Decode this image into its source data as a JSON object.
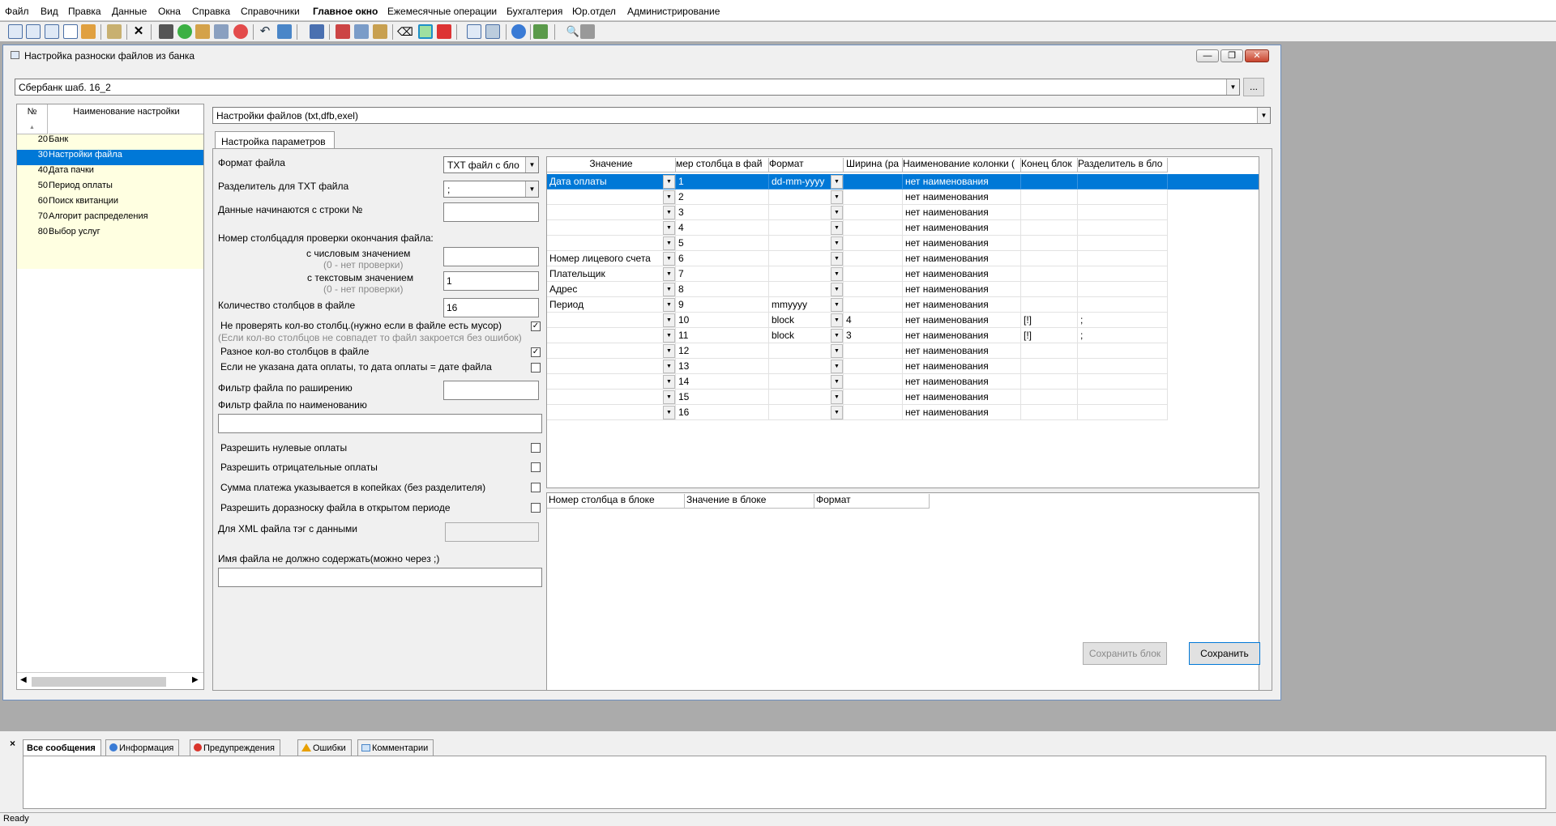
{
  "menu": [
    "Файл",
    "Вид",
    "Правка",
    "Данные",
    "Окна",
    "Справка",
    "Справочники",
    "Главное окно",
    "Ежемесячные операции",
    "Бухгалтерия",
    "Юр.отдел",
    "Администрирование"
  ],
  "window": {
    "title": "Настройка разноски файлов из банка",
    "template_value": "Сбербанк шаб. 16_2",
    "browse_label": "..."
  },
  "left_list": {
    "headers": [
      "№",
      "Наименование настройки"
    ],
    "items": [
      {
        "num": "20",
        "name": "Банк",
        "selected": false
      },
      {
        "num": "30",
        "name": "Настройки  файла",
        "selected": true
      },
      {
        "num": "40",
        "name": "Дата пачки",
        "selected": false
      },
      {
        "num": "50",
        "name": "Период оплаты",
        "selected": false
      },
      {
        "num": "60",
        "name": "Поиск квитанции",
        "selected": false
      },
      {
        "num": "70",
        "name": "Алгорит распределения",
        "selected": false
      },
      {
        "num": "80",
        "name": "Выбор услуг",
        "selected": false
      }
    ]
  },
  "settings_combo": "Настройки файлов (txt,dfb,exel)",
  "tab_label": "Настройка параметров",
  "form": {
    "file_format_label": "Формат файла",
    "file_format_value": "TXT файл с бло",
    "separator_label": "Разделитель для  TXT файла",
    "separator_value": ";",
    "start_row_label": "Данные начинаются с строки №",
    "start_row_value": "",
    "check_col_label": "Номер столбцадля проверки окончания файла:",
    "numeric_label": "с числовым значением",
    "numeric_hint": "(0 - нет проверки)",
    "numeric_value": "",
    "text_label": "с текстовым значением",
    "text_hint": "(0 - нет проверки)",
    "text_value": "1",
    "col_count_label": "Количество столбцов в файле",
    "col_count_value": "16",
    "no_check_cols_label": "Не проверять кол-во столбц.(нужно если в файле есть мусор)",
    "no_check_cols_hint": "(Если кол-во столбцов не совпадет то файл закроется без ошибок)",
    "diff_cols_label": "Разное кол-во столбцов в файле",
    "no_date_label": "Если не указана дата  оплаты, то дата оплаты = дате файла",
    "ext_filter_label": "Фильтр файла по раширению",
    "ext_filter_value": "",
    "name_filter_label": "Фильтр файла по наименованию",
    "name_filter_value": "",
    "zero_pay_label": "Разрешить нулевые оплаты",
    "neg_pay_label": "Разрешить отрицательные оплаты",
    "kopecks_label": "Сумма платежа указывается в копейках (без разделителя)",
    "open_period_label": "Разрешить доразноску файла в открытом периоде",
    "xml_tag_label": "Для XML файла тэг с данными",
    "xml_tag_value": "",
    "exclude_name_label": "Имя файла не должно содержать(можно через ;)",
    "exclude_name_value": "",
    "checks": {
      "no_check_cols": true,
      "diff_cols": true,
      "no_date": false,
      "zero_pay": false,
      "neg_pay": false,
      "kopecks": false,
      "open_period": false
    }
  },
  "grid": {
    "headers": [
      "Значение",
      "мер столбца в фай",
      "Формат",
      "Ширина (ра",
      "Наименование колонки (",
      "Конец блок",
      "Разделитель в бло"
    ],
    "rows": [
      {
        "value": "Дата оплаты",
        "col": "1",
        "format": "dd-mm-yyyy",
        "width": "",
        "name": "нет наименования",
        "end": "",
        "sep": ""
      },
      {
        "value": "",
        "col": "2",
        "format": "",
        "width": "",
        "name": "нет наименования",
        "end": "",
        "sep": ""
      },
      {
        "value": "",
        "col": "3",
        "format": "",
        "width": "",
        "name": "нет наименования",
        "end": "",
        "sep": ""
      },
      {
        "value": "",
        "col": "4",
        "format": "",
        "width": "",
        "name": "нет наименования",
        "end": "",
        "sep": ""
      },
      {
        "value": "",
        "col": "5",
        "format": "",
        "width": "",
        "name": "нет наименования",
        "end": "",
        "sep": ""
      },
      {
        "value": "Номер лицевого счета",
        "col": "6",
        "format": "",
        "width": "",
        "name": "нет наименования",
        "end": "",
        "sep": ""
      },
      {
        "value": "Плательщик",
        "col": "7",
        "format": "",
        "width": "",
        "name": "нет наименования",
        "end": "",
        "sep": ""
      },
      {
        "value": "Адрес",
        "col": "8",
        "format": "",
        "width": "",
        "name": "нет наименования",
        "end": "",
        "sep": ""
      },
      {
        "value": "Период",
        "col": "9",
        "format": "mmyyyy",
        "width": "",
        "name": "нет наименования",
        "end": "",
        "sep": ""
      },
      {
        "value": "",
        "col": "10",
        "format": "block",
        "width": "4",
        "name": "нет наименования",
        "end": "[!]",
        "sep": ";"
      },
      {
        "value": "",
        "col": "11",
        "format": "block",
        "width": "3",
        "name": "нет наименования",
        "end": "[!]",
        "sep": ";"
      },
      {
        "value": "",
        "col": "12",
        "format": "",
        "width": "",
        "name": "нет наименования",
        "end": "",
        "sep": ""
      },
      {
        "value": "",
        "col": "13",
        "format": "",
        "width": "",
        "name": "нет наименования",
        "end": "",
        "sep": ""
      },
      {
        "value": "",
        "col": "14",
        "format": "",
        "width": "",
        "name": "нет наименования",
        "end": "",
        "sep": ""
      },
      {
        "value": "",
        "col": "15",
        "format": "",
        "width": "",
        "name": "нет наименования",
        "end": "",
        "sep": ""
      },
      {
        "value": "",
        "col": "16",
        "format": "",
        "width": "",
        "name": "нет наименования",
        "end": "",
        "sep": ""
      }
    ]
  },
  "block_grid": {
    "headers": [
      "Номер столбца в блоке",
      "Значение в блоке",
      "Формат"
    ]
  },
  "buttons": {
    "save_block": "Сохранить блок",
    "save": "Сохранить"
  },
  "messages": {
    "tabs": [
      "Все сообщения",
      "Информация",
      "Предупреждения",
      "Ошибки",
      "Комментарии"
    ],
    "close": "×"
  },
  "status": "Ready",
  "colors": {
    "selection": "#0078d7",
    "list_band": "#ffffe1"
  }
}
